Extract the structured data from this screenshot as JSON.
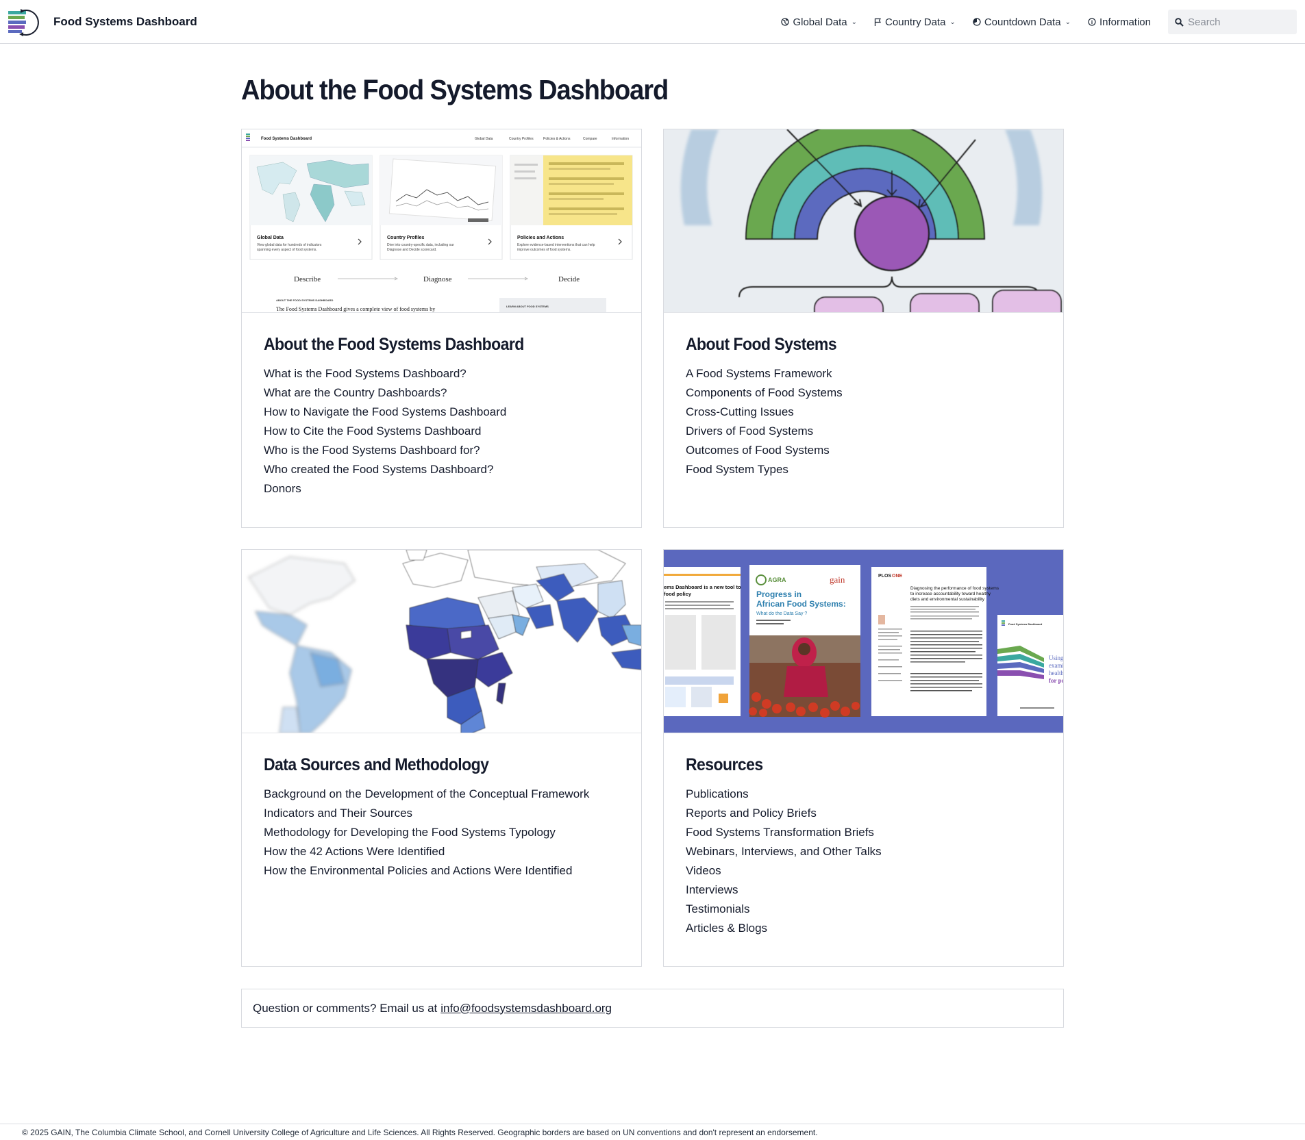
{
  "header": {
    "app_name": "Food Systems Dashboard",
    "logo_icon": "food-systems-logo-icon",
    "nav": [
      {
        "label": "Global Data",
        "icon": "globe-icon",
        "dropdown": true
      },
      {
        "label": "Country Data",
        "icon": "flag-icon",
        "dropdown": true
      },
      {
        "label": "Countdown Data",
        "icon": "countdown-icon",
        "dropdown": true
      },
      {
        "label": "Information",
        "icon": "info-icon",
        "dropdown": false
      }
    ],
    "search": {
      "placeholder": "Search",
      "value": "",
      "icon": "search-icon"
    }
  },
  "page": {
    "title": "About the Food Systems Dashboard"
  },
  "cards": [
    {
      "title": "About the Food Systems Dashboard",
      "image": "dashboard-preview-image",
      "image_text": {
        "brand": "Food Systems Dashboard",
        "nav": [
          "Global Data",
          "Country Profiles",
          "Policies & Actions",
          "Compare",
          "Information"
        ],
        "panels": [
          {
            "title": "Global Data",
            "desc1": "View global data for hundreds of indicators",
            "desc2": "spanning every aspect of food systems."
          },
          {
            "title": "Country Profiles",
            "desc1": "Dive into country-specific data, including our",
            "desc2": "Diagnose and Decide scorecard."
          },
          {
            "title": "Policies and Actions",
            "desc1": "Explore evidence-based interventions that can help",
            "desc2": "improve outcomes of food systems."
          }
        ],
        "flow": [
          "Describe",
          "Diagnose",
          "Decide"
        ],
        "about_label": "ABOUT THE FOOD SYSTEMS DASHBOARD",
        "about_text": "The Food Systems Dashboard gives a complete view of food systems by",
        "learn_label": "LEARN ABOUT FOOD SYSTEMS"
      },
      "links": [
        "What is the Food Systems Dashboard?",
        "What are the Country Dashboards?",
        "How to Navigate the Food Systems Dashboard",
        "How to Cite the Food Systems Dashboard",
        "Who is the Food Systems Dashboard for?",
        "Who created the Food Systems Dashboard?",
        "Donors"
      ]
    },
    {
      "title": "About Food Systems",
      "image": "food-systems-framework-image",
      "links": [
        "A Food Systems Framework",
        "Components of Food Systems",
        "Cross-Cutting Issues",
        "Drivers of Food Systems",
        "Outcomes of Food Systems",
        "Food System Types"
      ]
    },
    {
      "title": "Data Sources and Methodology",
      "image": "world-map-image",
      "links": [
        "Background on the Development of the Conceptual Framework",
        "Indicators and Their Sources",
        "Methodology for Developing the Food Systems Typology",
        "How the 42 Actions Were Identified",
        "How the Environmental Policies and Actions Were Identified"
      ]
    },
    {
      "title": "Resources",
      "image": "publications-collage-image",
      "image_text": {
        "doc1_title1": "ems Dashboard is a new tool to",
        "doc1_title2": "food policy",
        "agra": "AGRA",
        "gain": "gain",
        "doc2_title1": "Progress in",
        "doc2_title2": "African Food Systems:",
        "doc2_sub": "What do the Data Say ?",
        "plos": "PLOS",
        "plos_one": "ONE",
        "doc3_title1": "Diagnosing the performance of food systems",
        "doc3_title2": "to increase accountability toward healthy",
        "doc3_title3": "diets and environmental sustainability",
        "doc4_brand": "Food Systems Dashboard",
        "doc4_words": [
          "Using t",
          "exami",
          "health",
          "for pol"
        ]
      },
      "links": [
        "Publications",
        "Reports and Policy Briefs",
        "Food Systems Transformation Briefs",
        "Webinars, Interviews, and Other Talks",
        "Videos",
        "Interviews",
        "Testimonials",
        "Articles & Blogs"
      ]
    }
  ],
  "contact": {
    "text": "Question or comments? Email us at",
    "email": "info@foodsystemsdashboard.org"
  },
  "footer": {
    "text": "© 2025 GAIN, The Columbia Climate School, and Cornell University College of Agriculture and Life Sciences. All Rights Reserved. Geographic borders are based on UN conventions and don't represent an endorsement."
  }
}
